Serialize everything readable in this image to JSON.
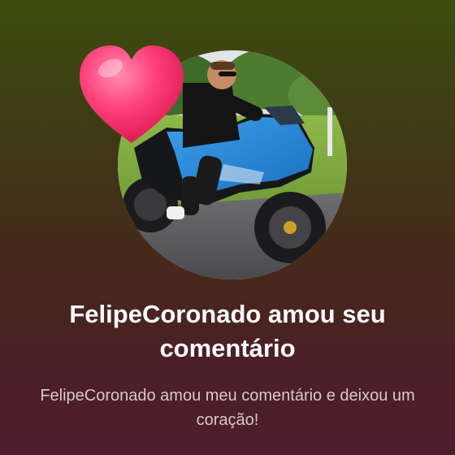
{
  "notification": {
    "title": "FelipeCoronado amou seu comentário",
    "message": "FelipeCoronado amou meu comentário e deixou um coração!"
  },
  "avatar": {
    "description_icon": "profile-photo"
  },
  "badge": {
    "icon": "heart-icon",
    "color": "#ff2f6e"
  }
}
